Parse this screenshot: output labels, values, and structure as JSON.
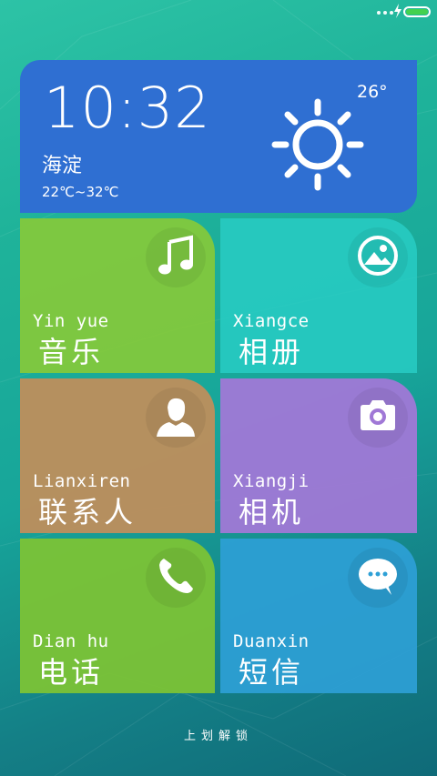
{
  "status_bar": {
    "signal_icon": "signal-dots-icon",
    "charging_icon": "bolt-icon",
    "battery_color": "#43d14f"
  },
  "clock": {
    "time": "10:32",
    "location": "海淀",
    "temp_range": "22℃~32℃",
    "current_temp": "26°",
    "weather_icon": "sun-icon"
  },
  "apps": [
    {
      "id": "music",
      "pinyin": "Yin yue",
      "label": "音乐",
      "icon": "music-note-icon",
      "color": "#84c93a"
    },
    {
      "id": "album",
      "pinyin": "Xiangce",
      "label": "相册",
      "icon": "gallery-icon",
      "color": "#28ccc4"
    },
    {
      "id": "contacts",
      "pinyin": "Lianxiren",
      "label": "联系人",
      "icon": "person-icon",
      "color": "#be8e5c"
    },
    {
      "id": "camera",
      "pinyin": "Xiangji",
      "label": "相机",
      "icon": "camera-icon",
      "color": "#a078d6"
    },
    {
      "id": "phone",
      "pinyin": "Dian hu",
      "label": "电话",
      "icon": "phone-icon",
      "color": "#7ec434"
    },
    {
      "id": "sms",
      "pinyin": "Duanxin",
      "label": "短信",
      "icon": "chat-bubble-icon",
      "color": "#2ea0d6"
    }
  ],
  "unlock_hint": "上划解锁"
}
